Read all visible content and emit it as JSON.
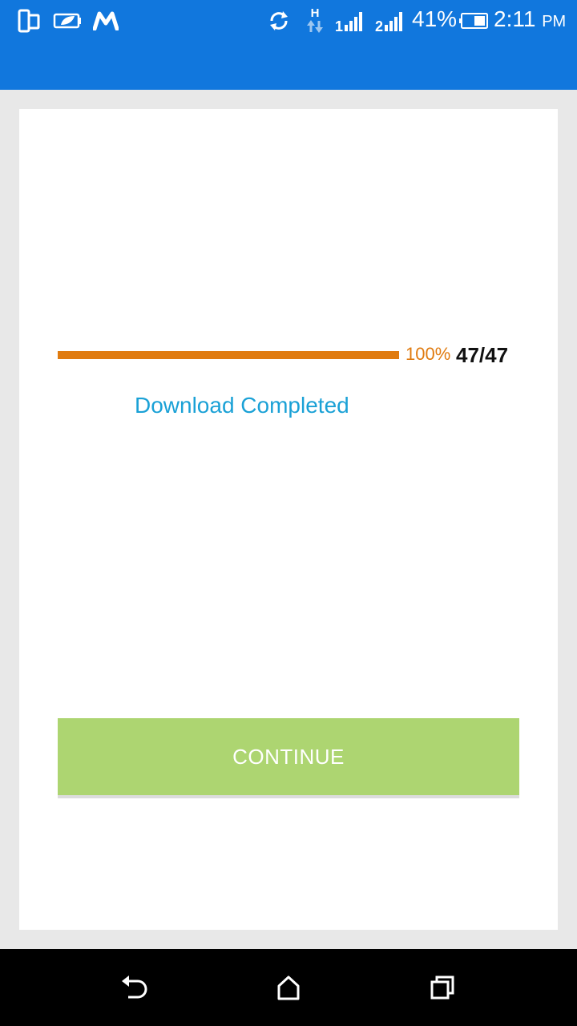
{
  "status_bar": {
    "background_color": "#1177dd",
    "left_icons": [
      "phone-dual-icon",
      "battery-saver-icon",
      "m-app-icon"
    ],
    "right_icons": [
      "sync-icon",
      "h-data-icon",
      "sim1-signal-icon",
      "sim2-signal-icon",
      "battery-icon"
    ],
    "sim1_label": "1",
    "sim2_label": "2",
    "data_type": "H",
    "battery_percent": "41%",
    "time": "2:11",
    "time_suffix": "PM"
  },
  "download": {
    "progress_fraction": 1.0,
    "percent_label": "100%",
    "count_label": "47/47",
    "message": "Download Completed",
    "progress_color": "#e07b10",
    "message_color": "#1aa1d6"
  },
  "actions": {
    "continue_label": "CONTINUE",
    "continue_color": "#add571"
  },
  "nav_bar": {
    "icons": [
      "back-icon",
      "home-icon",
      "recent-apps-icon"
    ]
  }
}
